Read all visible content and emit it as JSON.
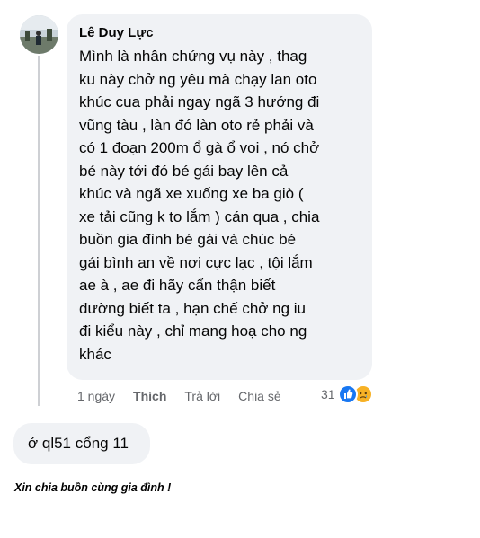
{
  "comment": {
    "author": "Lê Duy Lực",
    "text": "Mình là nhân chứng vụ này , thag\nku này chở ng yêu mà chạy lan oto\nkhúc cua phải ngay ngã 3 hướng đi\nvũng tàu , làn đó làn oto rẻ phải và\ncó 1 đoạn 200m ổ gà ổ voi , nó chở\nbé này tới đó bé gái bay lên cả\nkhúc và ngã xe xuống xe ba giò (\nxe tải cũng k to lắm ) cán qua , chia\nbuồn gia đình bé gái và chúc bé\ngái bình an về nơi cực lạc , tội lắm\nae à , ae đi hãy cẩn thận biết\nđường biết ta , hạn chế chở ng iu\nđi kiểu này , chỉ mang hoạ cho ng\nkhác",
    "time": "1 ngày",
    "like_label": "Thích",
    "reply_label": "Trả lời",
    "share_label": "Chia sẻ",
    "reaction_count": "31",
    "reaction_icons": [
      "like-icon",
      "sad-icon"
    ],
    "colors": {
      "like": "#1877f2",
      "sad": "#f7b125",
      "bubble": "#f0f2f5"
    }
  },
  "reply": {
    "text": "ở ql51 cổng 11"
  },
  "caption": {
    "text": "Xin chia buồn cùng gia đình !"
  }
}
